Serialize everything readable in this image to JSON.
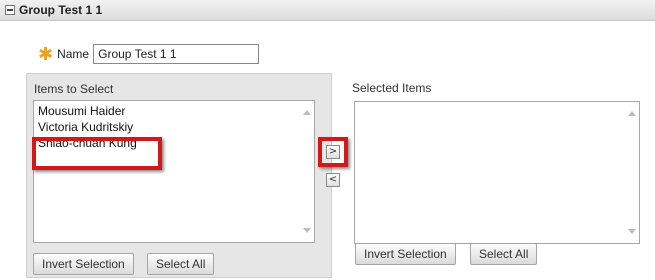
{
  "group": {
    "title": "Group Test 1 1"
  },
  "name_field": {
    "label": "Name",
    "value": "Group Test 1 1"
  },
  "left_panel": {
    "label": "Items to Select",
    "items": [
      "Mousumi Haider",
      "Victoria Kudritskiy",
      "Shiao-chuan Kung"
    ],
    "invert_label": "Invert Selection",
    "select_all_label": "Select All"
  },
  "right_panel": {
    "label": "Selected Items",
    "items": [],
    "invert_label": "Invert Selection",
    "select_all_label": "Select All"
  },
  "move_buttons": {
    "right_glyph": ">",
    "left_glyph": "<"
  },
  "icons": {
    "collapse": "minus-box-icon",
    "required": "asterisk-icon",
    "scroll_up": "triangle-up-icon",
    "scroll_down": "triangle-down-icon"
  },
  "colors": {
    "highlight": "#d21818",
    "required": "#f0a020",
    "panel_bg": "#e6e6e6"
  }
}
